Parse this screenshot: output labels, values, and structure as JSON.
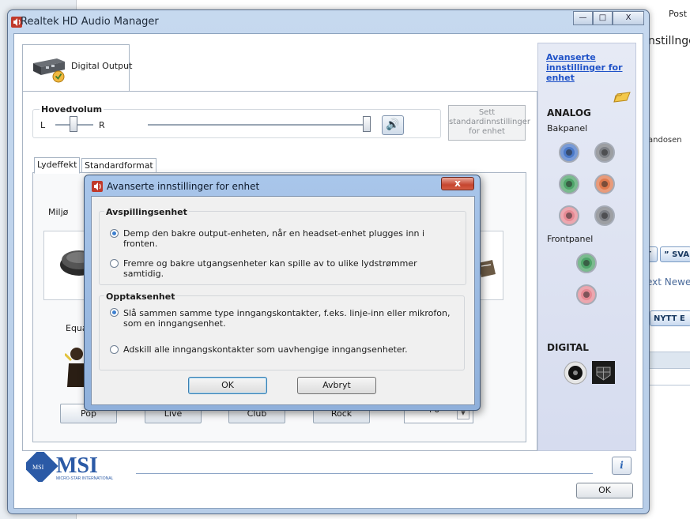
{
  "background": {
    "post": "Post",
    "innstillinger": "nstillnge",
    "handosen": "andosen",
    "btn_t": "T",
    "btn_sv": "SVA",
    "next": "ext Newe",
    "nytt": "NYTT E"
  },
  "window": {
    "title": "Realtek HD Audio Manager",
    "minimize": "—",
    "maximize": "□",
    "close": "X",
    "device_tab": "Digital Output",
    "master_volume_label": "Hovedvolum",
    "left_label": "L",
    "right_label": "R",
    "set_default_label": "Sett standardinnstillinger for enhet",
    "subtabs": [
      "Lydeffekt",
      "Standardformat"
    ],
    "env_label": "Miljø",
    "eq_label": "Equa",
    "eq_buttons": [
      "Pop",
      "Live",
      "Club",
      "Rock"
    ],
    "eq_select_value": "+0",
    "ok": "OK",
    "info": "i"
  },
  "sidebar": {
    "advanced_link": "Avanserte innstillinger for enhet",
    "analog": "ANALOG",
    "back_panel": "Bakpanel",
    "front_panel": "Frontpanel",
    "digital": "DIGITAL"
  },
  "logo": {
    "text": "MSI",
    "sub": "MICRO-STAR INTERNATIONAL"
  },
  "dialog": {
    "title": "Avanserte innstillinger for enhet",
    "close": "x",
    "playback_group": "Avspillingsenhet",
    "playback_opt1": "Demp den bakre output-enheten, når en headset-enhet plugges inn i fronten.",
    "playback_opt2": "Fremre og bakre utgangsenheter kan spille av to ulike lydstrømmer samtidig.",
    "record_group": "Opptaksenhet",
    "record_opt1": "Slå sammen samme type inngangskontakter, f.eks. linje-inn eller mikrofon, som en inngangsenhet.",
    "record_opt2": "Adskill alle inngangskontakter som uavhengige inngangsenheter.",
    "ok": "OK",
    "cancel": "Avbryt"
  },
  "colors": {
    "jack_blue": "#4b79c8",
    "jack_gray": "#7c7f85",
    "jack_green": "#4fa56a",
    "jack_orange": "#e07a4f",
    "jack_pink": "#e68a94",
    "link": "#1f52c8"
  }
}
